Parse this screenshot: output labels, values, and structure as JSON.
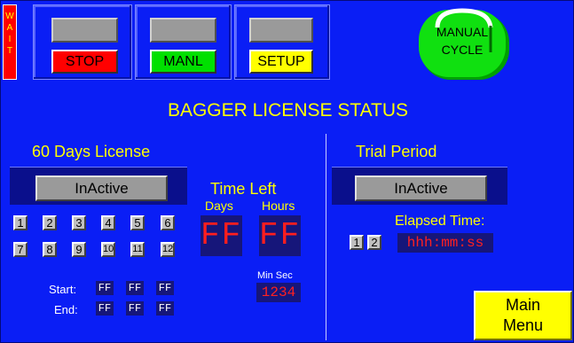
{
  "top": {
    "wait_letters": [
      "W",
      "A",
      "I",
      "T"
    ],
    "stop_label": "STOP",
    "manl_label": "MANL",
    "setup_label": "SETUP",
    "manual_cycle_line1": "MANUAL",
    "manual_cycle_line2": "CYCLE"
  },
  "title": "BAGGER LICENSE STATUS",
  "license": {
    "heading": "60 Days License",
    "status": "InActive",
    "buttons": [
      "1",
      "2",
      "3",
      "4",
      "5",
      "6",
      "7",
      "8",
      "9",
      "10",
      "11",
      "12"
    ],
    "start_label": "Start:",
    "end_label": "End:",
    "start_values": [
      "FF",
      "FF",
      "FF"
    ],
    "end_values": [
      "FF",
      "FF",
      "FF"
    ]
  },
  "time_left": {
    "heading": "Time Left",
    "days_label": "Days",
    "hours_label": "Hours",
    "days_value": "FF",
    "hours_value": "FF",
    "min_sec_label": "Min Sec",
    "min_sec_value": "1234"
  },
  "trial": {
    "heading": "Trial Period",
    "status": "InActive",
    "elapsed_label": "Elapsed Time:",
    "buttons": [
      "1",
      "2"
    ],
    "elapsed_value": "hhh:mm:ss"
  },
  "main_menu": {
    "line1": "Main",
    "line2": "Menu"
  },
  "colors": {
    "background": "#0a1ef5",
    "accent": "#ffff00",
    "stop": "#ff0000",
    "manl": "#00e000",
    "setup": "#ffff00"
  }
}
